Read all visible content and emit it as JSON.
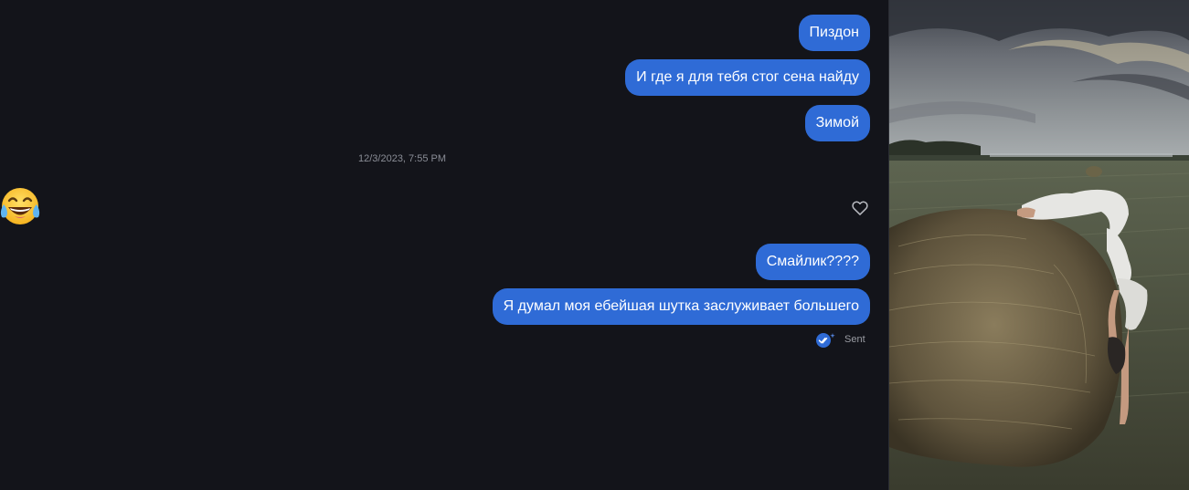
{
  "messages": [
    {
      "text": "Пиздон"
    },
    {
      "text": "И где я для тебя стог сена найду"
    },
    {
      "text": "Зимой"
    },
    {
      "text": "Смайлик????"
    },
    {
      "text": "Я думал моя ебейшая шутка заслуживает большего"
    }
  ],
  "timestamp": "12/3/2023, 7:55 PM",
  "reaction": {
    "emoji": "😂"
  },
  "status": {
    "text": "Sent"
  },
  "colors": {
    "background": "#13141a",
    "bubble": "#2f6bd6",
    "timestamp": "#8a8d96"
  },
  "icons": {
    "heart": "heart-icon",
    "status": "read-receipt-icon"
  }
}
